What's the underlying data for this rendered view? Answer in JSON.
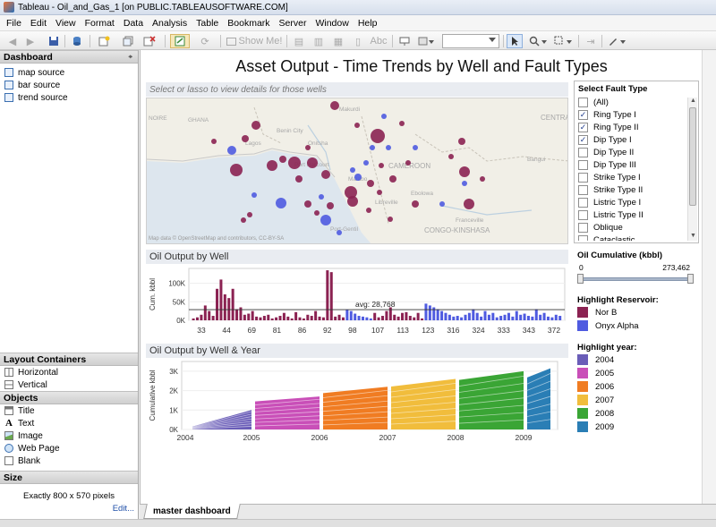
{
  "window": {
    "title": "Tableau - Oil_and_Gas_1 [on PUBLIC.TABLEAUSOFTWARE.COM]"
  },
  "menu": [
    "File",
    "Edit",
    "View",
    "Format",
    "Data",
    "Analysis",
    "Table",
    "Bookmark",
    "Server",
    "Window",
    "Help"
  ],
  "toolbar": {
    "show_me": "Show Me!",
    "abc": "Abc"
  },
  "left_panel": {
    "dashboard_header": "Dashboard",
    "sources": [
      "map source",
      "bar source",
      "trend source"
    ],
    "layout_header": "Layout Containers",
    "layout_items": [
      "Horizontal",
      "Vertical"
    ],
    "objects_header": "Objects",
    "objects": [
      "Title",
      "Text",
      "Image",
      "Web Page",
      "Blank"
    ],
    "size_header": "Size",
    "size_value": "Exactly 800 x 570 pixels",
    "edit_link": "Edit..."
  },
  "tab": {
    "label": "master dashboard"
  },
  "dashboard": {
    "title": "Asset Output - Time Trends by Well and Fault Types",
    "map_hint": "Select or lasso to view details for those wells",
    "map_attribution": "Map data © OpenStreetMap and contributors, CC-BY-SA",
    "map_labels": [
      "NOIRE",
      "GHANA",
      "Makurdi",
      "Benin City",
      "Onitsha",
      "Port Harcourt",
      "Malabo",
      "CAMEROON",
      "Libreville",
      "Ebolowa",
      "Port-Gentil",
      "CONGO-KINSHASA",
      "CENTRAL AFRICAN REPUBLIC",
      "Bangui",
      "Franceville",
      "Lagos"
    ],
    "bar_title": "Oil Output by Well",
    "trend_title": "Oil Output by Well & Year"
  },
  "filters": {
    "fault_title": "Select Fault Type",
    "fault_types": [
      {
        "label": "(All)",
        "checked": false
      },
      {
        "label": "Ring Type I",
        "checked": true
      },
      {
        "label": "Ring Type II",
        "checked": true
      },
      {
        "label": "Dip Type I",
        "checked": true
      },
      {
        "label": "Dip Type II",
        "checked": false
      },
      {
        "label": "Dip Type III",
        "checked": false
      },
      {
        "label": "Strike Type I",
        "checked": false
      },
      {
        "label": "Strike Type II",
        "checked": false
      },
      {
        "label": "Listric Type I",
        "checked": false
      },
      {
        "label": "Listric Type II",
        "checked": false
      },
      {
        "label": "Oblique",
        "checked": false
      },
      {
        "label": "Cataclastic",
        "checked": false
      }
    ],
    "cumulative_title": "Oil Cumulative (kbbl)",
    "cumulative_min": "0",
    "cumulative_max": "273,462",
    "reservoir_title": "Highlight Reservoir:",
    "reservoirs": [
      {
        "label": "Nor B",
        "color": "#8b2252"
      },
      {
        "label": "Onyx Alpha",
        "color": "#4f5be0"
      }
    ],
    "year_title": "Highlight year:",
    "years": [
      {
        "label": "2004",
        "color": "#6a5db8"
      },
      {
        "label": "2005",
        "color": "#c94fb8"
      },
      {
        "label": "2006",
        "color": "#f07c22"
      },
      {
        "label": "2007",
        "color": "#f1bd3c"
      },
      {
        "label": "2008",
        "color": "#3aa535"
      },
      {
        "label": "2009",
        "color": "#2a7eb5"
      }
    ]
  },
  "chart_data": [
    {
      "type": "bar",
      "title": "Oil Output by Well",
      "ylabel": "Cum. kbbl",
      "ylim": [
        0,
        140000
      ],
      "yticks": [
        "0K",
        "50K",
        "100K"
      ],
      "xticks": [
        "33",
        "44",
        "69",
        "81",
        "86",
        "92",
        "98",
        "107",
        "113",
        "123",
        "316",
        "324",
        "333",
        "343",
        "372"
      ],
      "reference_line": {
        "label": "avg: 28,768",
        "value": 28768
      },
      "series": [
        {
          "name": "Nor B",
          "color": "#8b2252",
          "values": [
            5000,
            8000,
            15000,
            40000,
            25000,
            12000,
            85000,
            110000,
            70000,
            60000,
            85000,
            30000,
            35000,
            15000,
            18000,
            25000,
            10000,
            8000,
            12000,
            15000,
            5000,
            8000,
            12000,
            20000,
            10000,
            5000,
            22000,
            8000,
            5000,
            15000,
            12000,
            25000,
            10000,
            8000,
            135000,
            130000,
            10000,
            15000,
            8000
          ]
        },
        {
          "name": "Onyx Alpha",
          "color": "#4f5be0",
          "values": [
            28000,
            25000,
            18000,
            12000,
            10000,
            8000,
            5000
          ]
        },
        {
          "name": "Nor B",
          "color": "#8b2252",
          "values": [
            20000,
            8000,
            12000,
            25000,
            35000,
            15000,
            10000,
            20000,
            22000,
            12000,
            8000,
            20000,
            5000
          ]
        },
        {
          "name": "Onyx Alpha",
          "color": "#4f5be0",
          "values": [
            45000,
            40000,
            35000,
            30000,
            25000,
            20000,
            15000,
            10000,
            12000,
            8000,
            15000,
            20000,
            30000,
            20000,
            10000,
            25000,
            15000,
            20000,
            8000,
            12000,
            15000,
            20000,
            10000,
            25000,
            15000,
            18000,
            12000,
            10000,
            30000,
            15000,
            20000,
            10000,
            8000,
            15000,
            12000
          ]
        }
      ]
    },
    {
      "type": "area",
      "title": "Oil Output by Well & Year",
      "ylabel": "Cumulative kbbl",
      "ylim": [
        0,
        3500
      ],
      "yticks": [
        "0K",
        "1K",
        "2K",
        "3K"
      ],
      "xticks": [
        "2004",
        "2005",
        "2006",
        "2007",
        "2008",
        "2009"
      ],
      "series": [
        {
          "name": "2004",
          "color": "#6a5db8",
          "values": [
            1000
          ]
        },
        {
          "name": "2005",
          "color": "#c94fb8",
          "values": [
            1700
          ]
        },
        {
          "name": "2006",
          "color": "#f07c22",
          "values": [
            2200
          ]
        },
        {
          "name": "2007",
          "color": "#f1bd3c",
          "values": [
            2600
          ]
        },
        {
          "name": "2008",
          "color": "#3aa535",
          "values": [
            3000
          ]
        },
        {
          "name": "2009",
          "color": "#2a7eb5",
          "values": [
            3150
          ]
        }
      ]
    }
  ]
}
